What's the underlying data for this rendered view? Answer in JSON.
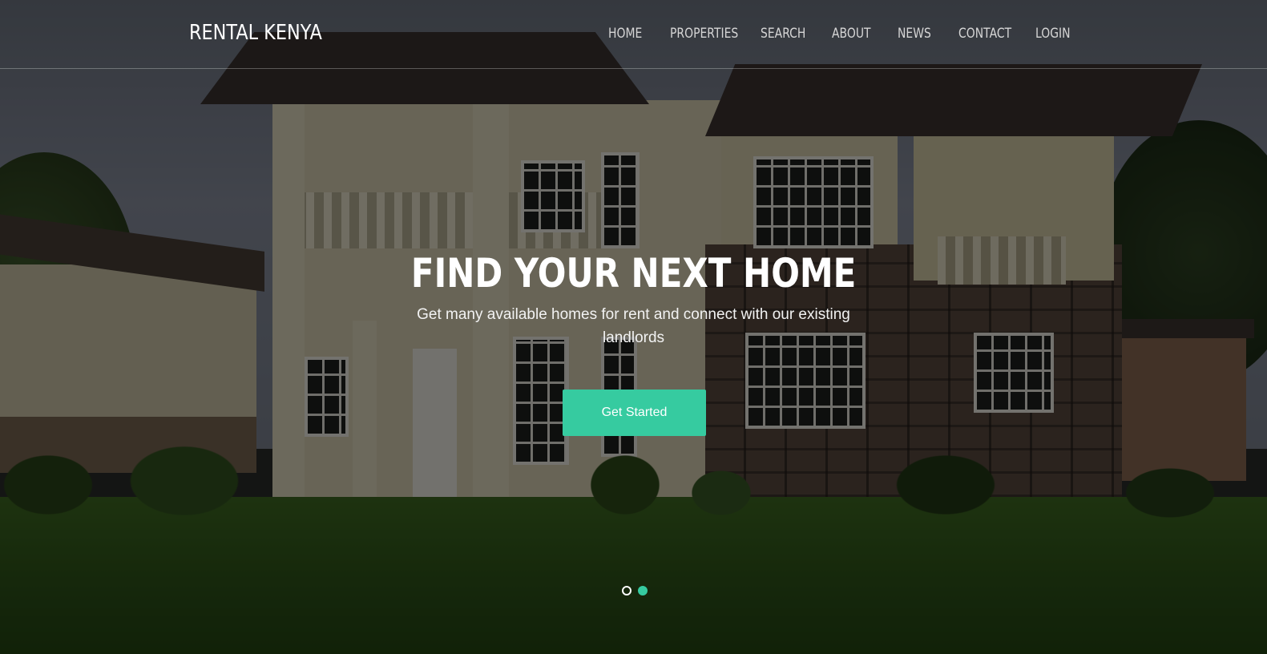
{
  "brand": {
    "name": "RENTAL KENYA"
  },
  "nav": {
    "items": [
      {
        "label": "HOME"
      },
      {
        "label": "PROPERTIES"
      },
      {
        "label": "SEARCH"
      },
      {
        "label": "ABOUT"
      },
      {
        "label": "NEWS"
      },
      {
        "label": "CONTACT"
      },
      {
        "label": "LOGIN"
      }
    ]
  },
  "hero": {
    "title": "FIND YOUR NEXT HOME",
    "subtitle": "Get many available homes for rent and connect with our existing landlords",
    "cta_label": "Get Started",
    "background_image": "house-photo",
    "slides_total": 2,
    "active_slide": 2
  },
  "colors": {
    "accent": "#36cba0",
    "overlay": "rgba(0,0,0,0.52)",
    "nav_text": "#d6d6d6",
    "text": "#ffffff"
  }
}
